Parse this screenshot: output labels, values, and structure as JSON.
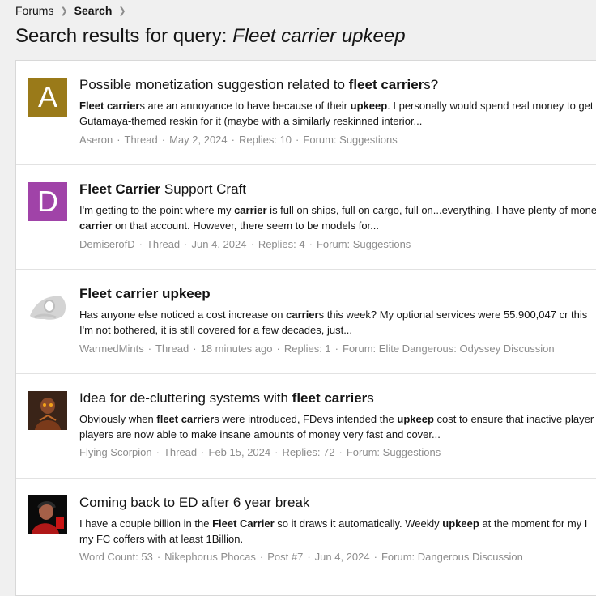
{
  "breadcrumb": {
    "items": [
      "Forums",
      "Search"
    ]
  },
  "header": {
    "title_prefix": "Search results for query: ",
    "query": "Fleet carrier upkeep"
  },
  "colors": {
    "avatar_a": "#9a7a19",
    "avatar_d": "#a043a8",
    "meta_text": "#8c8c8c"
  },
  "results": [
    {
      "avatar_letter": "A",
      "title": [
        {
          "t": "Possible monetization suggestion related to ",
          "b": false
        },
        {
          "t": "fleet carrier",
          "b": true
        },
        {
          "t": "s?",
          "b": false
        }
      ],
      "snippet1": [
        {
          "t": "Fleet carrier",
          "b": true
        },
        {
          "t": "s are an annoyance to have because of their ",
          "b": false
        },
        {
          "t": "upkeep",
          "b": true
        },
        {
          "t": ". I personally would spend real money to get",
          "b": false
        }
      ],
      "snippet2": [
        {
          "t": "Gutamaya-themed reskin for it (maybe with a similarly reskinned interior...",
          "b": false
        }
      ],
      "meta": [
        "Aseron",
        "Thread",
        "May 2, 2024",
        "Replies: 10",
        "Forum: Suggestions"
      ]
    },
    {
      "avatar_letter": "D",
      "title": [
        {
          "t": "Fleet Carrier",
          "b": true
        },
        {
          "t": " Support Craft",
          "b": false
        }
      ],
      "snippet1": [
        {
          "t": "I'm getting to the point where my ",
          "b": false
        },
        {
          "t": "carrier",
          "b": true
        },
        {
          "t": " is full on ships, full on cargo, full on...everything. I have plenty of mone",
          "b": false
        }
      ],
      "snippet2": [
        {
          "t": "carrier",
          "b": true
        },
        {
          "t": " on that account. However, there seem to be models for...",
          "b": false
        }
      ],
      "meta": [
        "DemiserofD",
        "Thread",
        "Jun 4, 2024",
        "Replies: 4",
        "Forum: Suggestions"
      ]
    },
    {
      "avatar_letter": "",
      "title": [
        {
          "t": "Fleet carrier upkeep",
          "b": true
        }
      ],
      "snippet1": [
        {
          "t": "Has anyone else noticed a cost increase on ",
          "b": false
        },
        {
          "t": "carrier",
          "b": true
        },
        {
          "t": "s this week? My optional services were 55.900,047 cr this",
          "b": false
        }
      ],
      "snippet2": [
        {
          "t": "I'm not bothered, it is still covered for a few decades, just...",
          "b": false
        }
      ],
      "meta": [
        "WarmedMints",
        "Thread",
        "18 minutes ago",
        "Replies: 1",
        "Forum: Elite Dangerous: Odyssey Discussion"
      ]
    },
    {
      "avatar_letter": "",
      "title": [
        {
          "t": "Idea for de-cluttering systems with ",
          "b": false
        },
        {
          "t": "fleet carrier",
          "b": true
        },
        {
          "t": "s",
          "b": false
        }
      ],
      "snippet1": [
        {
          "t": "Obviously when ",
          "b": false
        },
        {
          "t": "fleet carrier",
          "b": true
        },
        {
          "t": "s were introduced, FDevs intended the ",
          "b": false
        },
        {
          "t": "upkeep",
          "b": true
        },
        {
          "t": " cost to ensure that inactive player",
          "b": false
        }
      ],
      "snippet2": [
        {
          "t": "players are now able to make insane amounts of money very fast and cover...",
          "b": false
        }
      ],
      "meta": [
        "Flying Scorpion",
        "Thread",
        "Feb 15, 2024",
        "Replies: 72",
        "Forum: Suggestions"
      ]
    },
    {
      "avatar_letter": "",
      "title": [
        {
          "t": "Coming back to ED after 6 year break",
          "b": false
        }
      ],
      "snippet1": [
        {
          "t": "I have a couple billion in the ",
          "b": false
        },
        {
          "t": "Fleet Carrier",
          "b": true
        },
        {
          "t": " so it draws it automatically. Weekly ",
          "b": false
        },
        {
          "t": "upkeep",
          "b": true
        },
        {
          "t": " at the moment for my I",
          "b": false
        }
      ],
      "snippet2": [
        {
          "t": "my FC coffers with at least 1Billion.",
          "b": false
        }
      ],
      "meta": [
        "Word Count: 53",
        "Nikephorus Phocas",
        "Post #7",
        "Jun 4, 2024",
        "Forum: Dangerous Discussion"
      ]
    }
  ]
}
